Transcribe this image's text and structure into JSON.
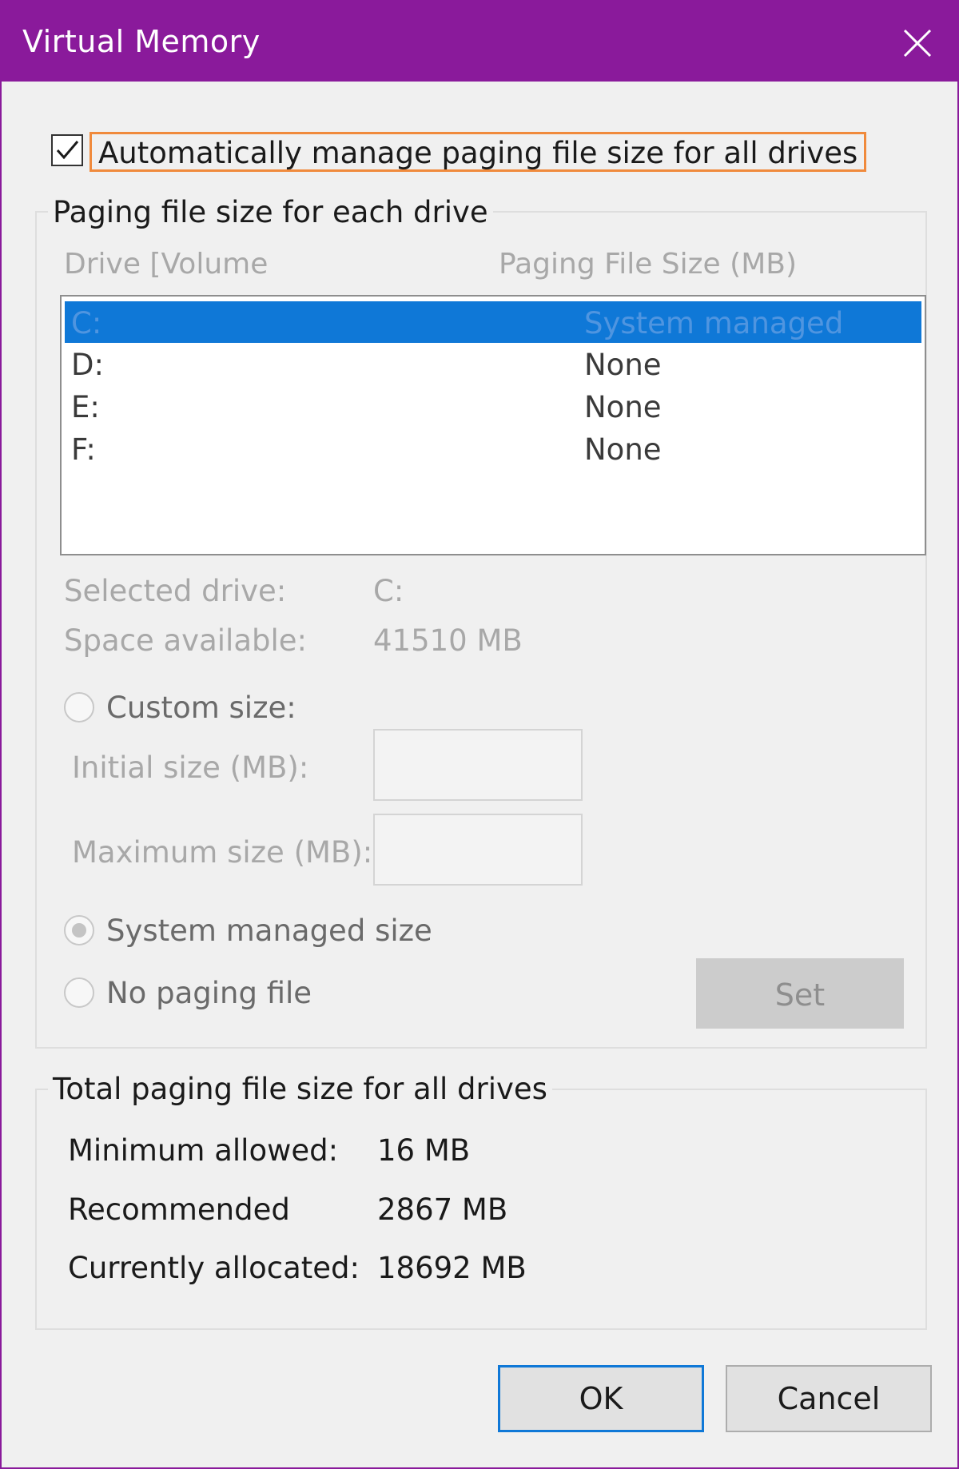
{
  "window": {
    "title": "Virtual Memory"
  },
  "auto_manage": {
    "label": "Automatically manage paging file size for all drives",
    "checked": true
  },
  "paging_group": {
    "title": "Paging file size for each drive",
    "col_drive": "Drive  [Volume",
    "col_size": "Paging File Size (MB)",
    "drives": [
      {
        "drive": "C:",
        "size": "System managed",
        "selected": true
      },
      {
        "drive": "D:",
        "size": "None"
      },
      {
        "drive": "E:",
        "size": "None"
      },
      {
        "drive": "F:",
        "size": "None"
      }
    ],
    "selected_drive_label": "Selected drive:",
    "selected_drive_value": "C:",
    "space_available_label": "Space available:",
    "space_available_value": "41510 MB",
    "custom_size_label": "Custom size:",
    "initial_size_label": "Initial size (MB):",
    "maximum_size_label": "Maximum size (MB):",
    "system_managed_label": "System managed size",
    "no_paging_label": "No paging file",
    "set_label": "Set"
  },
  "total_group": {
    "title": "Total paging file size for all drives",
    "min_label": "Minimum allowed:",
    "min_value": "16 MB",
    "rec_label": "Recommended",
    "rec_value": "2867 MB",
    "cur_label": "Currently allocated:",
    "cur_value": "18692 MB"
  },
  "buttons": {
    "ok": "OK",
    "cancel": "Cancel"
  },
  "colors": {
    "titlebar": "#8a1a9b",
    "selection": "#0f78d7",
    "focus_outline": "#f08a3c"
  }
}
